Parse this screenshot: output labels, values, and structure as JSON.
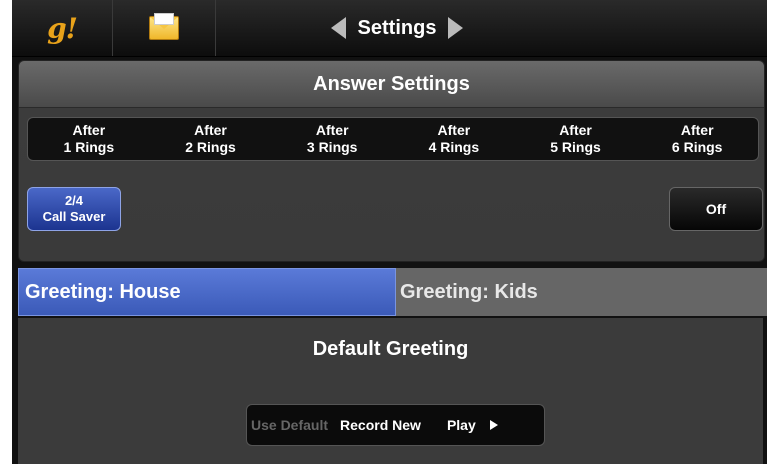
{
  "topbar": {
    "logo_text": "g!",
    "mail_icon": "envelope-icon",
    "title": "Settings",
    "prev_icon": "triangle-left-icon",
    "next_icon": "triangle-right-icon"
  },
  "answer_settings": {
    "title": "Answer Settings",
    "rings": [
      {
        "top": "After",
        "bottom": "1 Rings"
      },
      {
        "top": "After",
        "bottom": "2 Rings"
      },
      {
        "top": "After",
        "bottom": "3 Rings"
      },
      {
        "top": "After",
        "bottom": "4 Rings"
      },
      {
        "top": "After",
        "bottom": "5 Rings"
      },
      {
        "top": "After",
        "bottom": "6 Rings"
      }
    ],
    "call_saver": {
      "count": "2/4",
      "label": "Call Saver"
    },
    "off_label": "Off"
  },
  "greeting_tabs": [
    {
      "label": "Greeting: House",
      "active": true
    },
    {
      "label": "Greeting: Kids",
      "active": false
    }
  ],
  "default_greeting": {
    "title": "Default Greeting",
    "use_default": "Use Default",
    "record_new": "Record New",
    "play": "Play"
  },
  "colors": {
    "accent_blue": "#3b5ab8",
    "logo_orange": "#e8a21a"
  }
}
